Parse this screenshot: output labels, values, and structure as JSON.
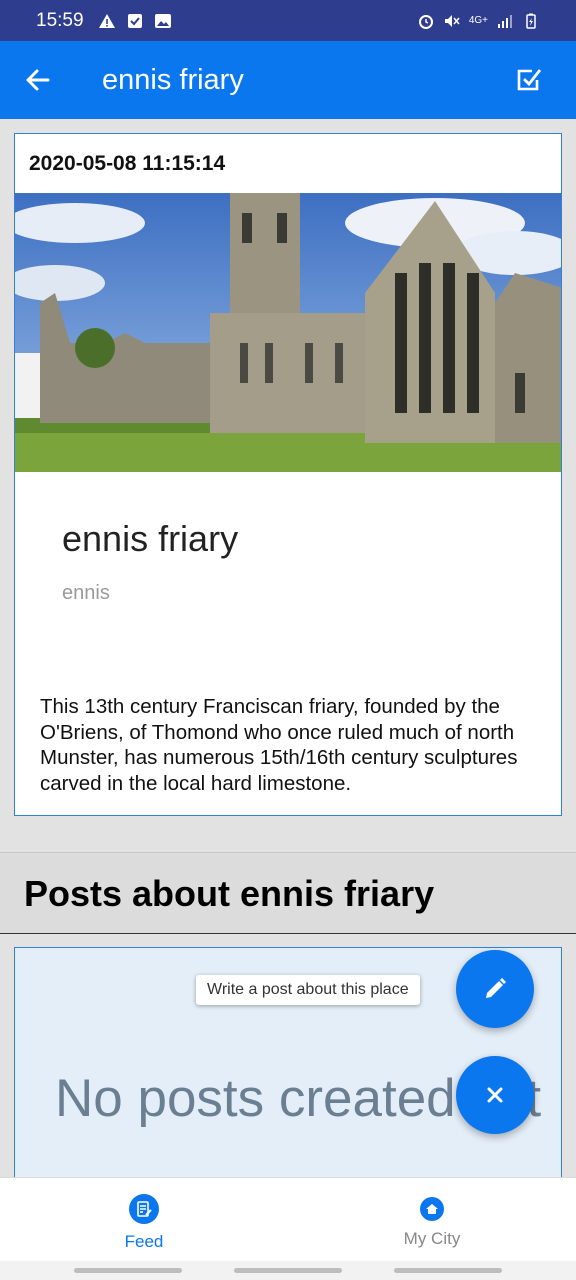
{
  "status_bar": {
    "time": "15:59",
    "left_icons": [
      "warning-icon",
      "checkbox-icon",
      "image-icon"
    ],
    "right_icons": [
      "alarm-icon",
      "mute-icon",
      "4g-icon",
      "signal-icon",
      "battery-icon"
    ],
    "network": "4G+"
  },
  "app_bar": {
    "title": "ennis friary",
    "back_icon": "arrow-left-icon",
    "action_icon": "check-square-icon",
    "color": "#0a77ee"
  },
  "place": {
    "date": "2020-05-08 11:15:14",
    "name": "ennis friary",
    "city": "ennis",
    "description": "This 13th century Franciscan friary, founded by the O'Briens, of Thomond who once ruled much of north Munster, has numerous 15th/16th century sculptures carved in the local hard limestone."
  },
  "posts": {
    "title": "Posts about ennis friary",
    "empty_text": "No posts created yet"
  },
  "fab": {
    "tooltip": "Write a post about this place",
    "edit_icon": "pencil-icon",
    "close_icon": "close-icon"
  },
  "bottom_nav": {
    "items": [
      {
        "label": "Feed",
        "icon": "feed-icon",
        "active": true
      },
      {
        "label": "My City",
        "icon": "home-icon",
        "active": false
      }
    ]
  },
  "colors": {
    "accent": "#0a77ee",
    "status_bar": "#2f3d8f",
    "empty_text": "#6b7f93"
  }
}
